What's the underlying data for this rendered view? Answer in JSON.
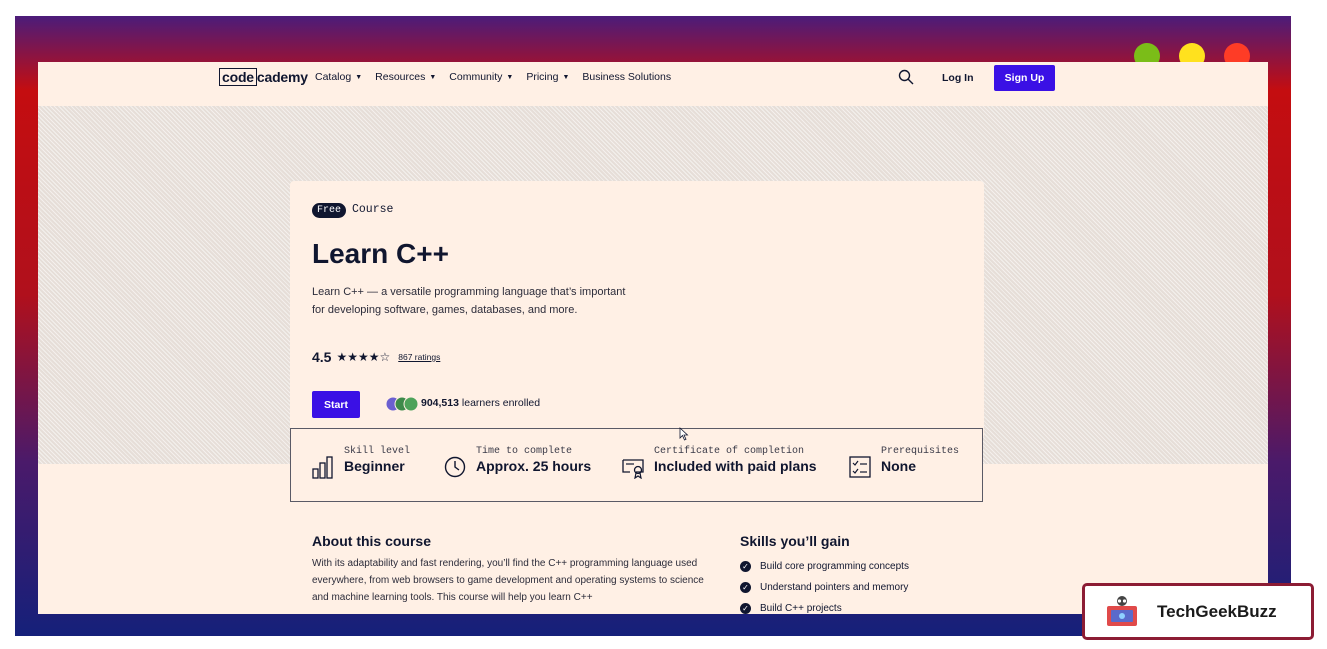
{
  "nav": {
    "logo_box": "code",
    "logo_rest": "cademy",
    "menu": [
      {
        "label": "Catalog",
        "caret": true
      },
      {
        "label": "Resources",
        "caret": true
      },
      {
        "label": "Community",
        "caret": true
      },
      {
        "label": "Pricing",
        "caret": true
      },
      {
        "label": "Business Solutions",
        "caret": false
      }
    ],
    "login": "Log In",
    "signup": "Sign Up"
  },
  "course": {
    "badge": "Free",
    "type": "Course",
    "title": "Learn C++",
    "description": "Learn C++ — a versatile programming language that’s important for developing software, games, databases, and more.",
    "rating": "4.5",
    "stars_out_of_5": 4.5,
    "ratings_count": "867 ratings",
    "start_button": "Start",
    "learners_count": "904,513",
    "learners_text": "learners enrolled"
  },
  "stats": [
    {
      "icon": "bar-chart-icon",
      "label": "Skill level",
      "value": "Beginner"
    },
    {
      "icon": "clock-icon",
      "label": "Time to complete",
      "value": "Approx. 25 hours"
    },
    {
      "icon": "certificate-icon",
      "label": "Certificate of completion",
      "value": "Included with paid plans"
    },
    {
      "icon": "checklist-icon",
      "label": "Prerequisites",
      "value": "None"
    }
  ],
  "about": {
    "title": "About this course",
    "text": "With its adaptability and fast rendering, you’ll find the C++ programming language used everywhere, from web browsers to game development and operating systems to science and machine learning tools. This course will help you learn C++"
  },
  "skills": {
    "title": "Skills you’ll gain",
    "items": [
      "Build core programming concepts",
      "Understand pointers and memory",
      "Build C++ projects"
    ]
  },
  "watermark": {
    "text": "TechGeekBuzz"
  },
  "colors": {
    "accent": "#3a10e5",
    "background": "#fff0e5",
    "text": "#10162f",
    "frame_red": "#c40d10",
    "frame_blue": "#15207a",
    "dot_green": "#7bbd18",
    "dot_yellow": "#ffe11e",
    "dot_red": "#fe3c26"
  }
}
